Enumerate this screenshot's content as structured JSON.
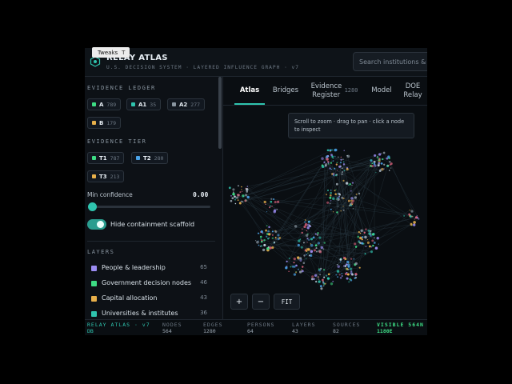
{
  "tweaks": {
    "label": "Tweaks",
    "close": "T"
  },
  "header": {
    "title": "RELAY ATLAS",
    "subtitle": "U.S. DECISION SYSTEM · LAYERED INFLUENCE GRAPH · v7",
    "search_placeholder": "Search institutions &"
  },
  "sidebar": {
    "evidence_ledger": {
      "title": "EVIDENCE LEDGER",
      "chips": [
        {
          "label": "A",
          "count": "789",
          "color": "#3ddc84"
        },
        {
          "label": "A1",
          "count": "35",
          "color": "#2fc4ae"
        },
        {
          "label": "A2",
          "count": "277",
          "color": "#8a96a1"
        },
        {
          "label": "B",
          "count": "179",
          "color": "#e8b04a"
        }
      ]
    },
    "evidence_tier": {
      "title": "EVIDENCE TIER",
      "chips": [
        {
          "label": "T1",
          "count": "787",
          "color": "#3ddc84"
        },
        {
          "label": "T2",
          "count": "280",
          "color": "#4aa3e8"
        },
        {
          "label": "T3",
          "count": "213",
          "color": "#e8b04a"
        }
      ]
    },
    "min_confidence": {
      "label": "Min confidence",
      "value": "0.00"
    },
    "toggle": {
      "label": "Hide containment scaffold"
    },
    "layers": {
      "title": "LAYERS",
      "items": [
        {
          "name": "People & leadership",
          "count": "65",
          "color": "#9b8cf2"
        },
        {
          "name": "Government decision nodes",
          "count": "46",
          "color": "#3ddc84"
        },
        {
          "name": "Capital allocation",
          "count": "43",
          "color": "#e8b04a"
        },
        {
          "name": "Universities & institutes",
          "count": "36",
          "color": "#2fc4ae"
        }
      ]
    }
  },
  "tabs": [
    {
      "label": "Atlas",
      "badge": ""
    },
    {
      "label": "Bridges",
      "badge": ""
    },
    {
      "label": "Evidence Register",
      "badge": "1280"
    },
    {
      "label": "Model",
      "badge": ""
    },
    {
      "label": "DOE Relay",
      "badge": ""
    }
  ],
  "hint": "Scroll to zoom · drag to pan · click a node to inspect",
  "controls": {
    "zoom_in": "+",
    "zoom_out": "−",
    "fit": "FIT"
  },
  "footer": {
    "brand": "RELAY ATLAS · v7",
    "brand_sub": "DB",
    "nodes_k": "NODES",
    "nodes_v": "564",
    "edges_k": "EDGES",
    "edges_v": "1280",
    "persons_k": "PERSONS",
    "persons_v": "64",
    "layers_k": "LAYERS",
    "layers_v": "43",
    "sources_k": "SOURCES",
    "sources_v": "82",
    "visible_k": "VISIBLE 564N",
    "visible_v": "1180E"
  }
}
